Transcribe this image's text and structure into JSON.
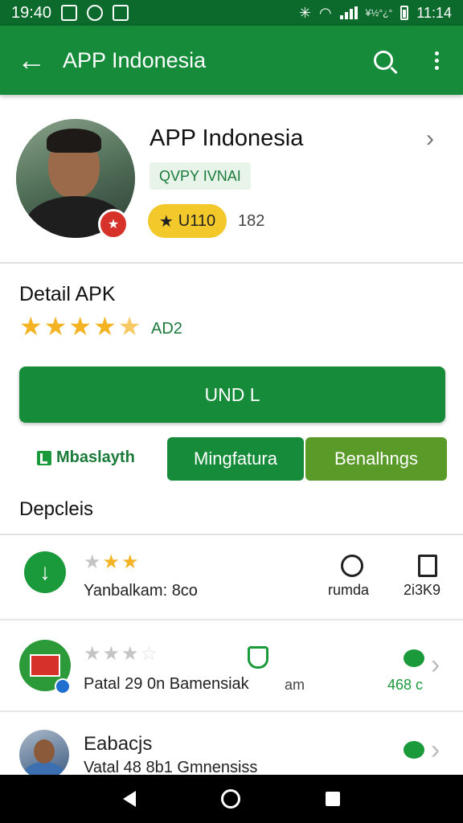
{
  "status_bar": {
    "time": "19:40",
    "small_text": "¥½°¿°",
    "clock_right": "11:14"
  },
  "app_bar": {
    "title": "APP Indonesia",
    "icons": [
      "back-arrow-icon",
      "search-icon",
      "overflow-menu-icon"
    ]
  },
  "profile": {
    "name": "APP Indonesia",
    "chip": "QVPY IVNAI",
    "badge_label": "U110",
    "count": "182"
  },
  "detail": {
    "title": "Detail APK",
    "stars_filled": 4.5,
    "rating_text": "AD2",
    "install_label": "UND L",
    "brand_label": "Mbaslayth",
    "tab_primary": "Mingfatura",
    "tab_secondary": "Benalhngs",
    "section_label": "Depcleis"
  },
  "list": {
    "row1": {
      "text": "Yanbalkam: 8co",
      "stars_filled": 2.5,
      "action_label": "rumda",
      "action_value": "2i3K9"
    },
    "row2": {
      "text": "Patal 29 0n Bamensiak",
      "stars_filled": 3,
      "meta": "am",
      "count": "468 c"
    },
    "row3": {
      "title": "Eabacjs",
      "text": "Vatal 48 8b1 Gmnensiss"
    }
  },
  "colors": {
    "app_bar": "#168b3a",
    "status_bar": "#0b6a2c",
    "star": "#f4b323",
    "badge": "#f3c82b"
  }
}
